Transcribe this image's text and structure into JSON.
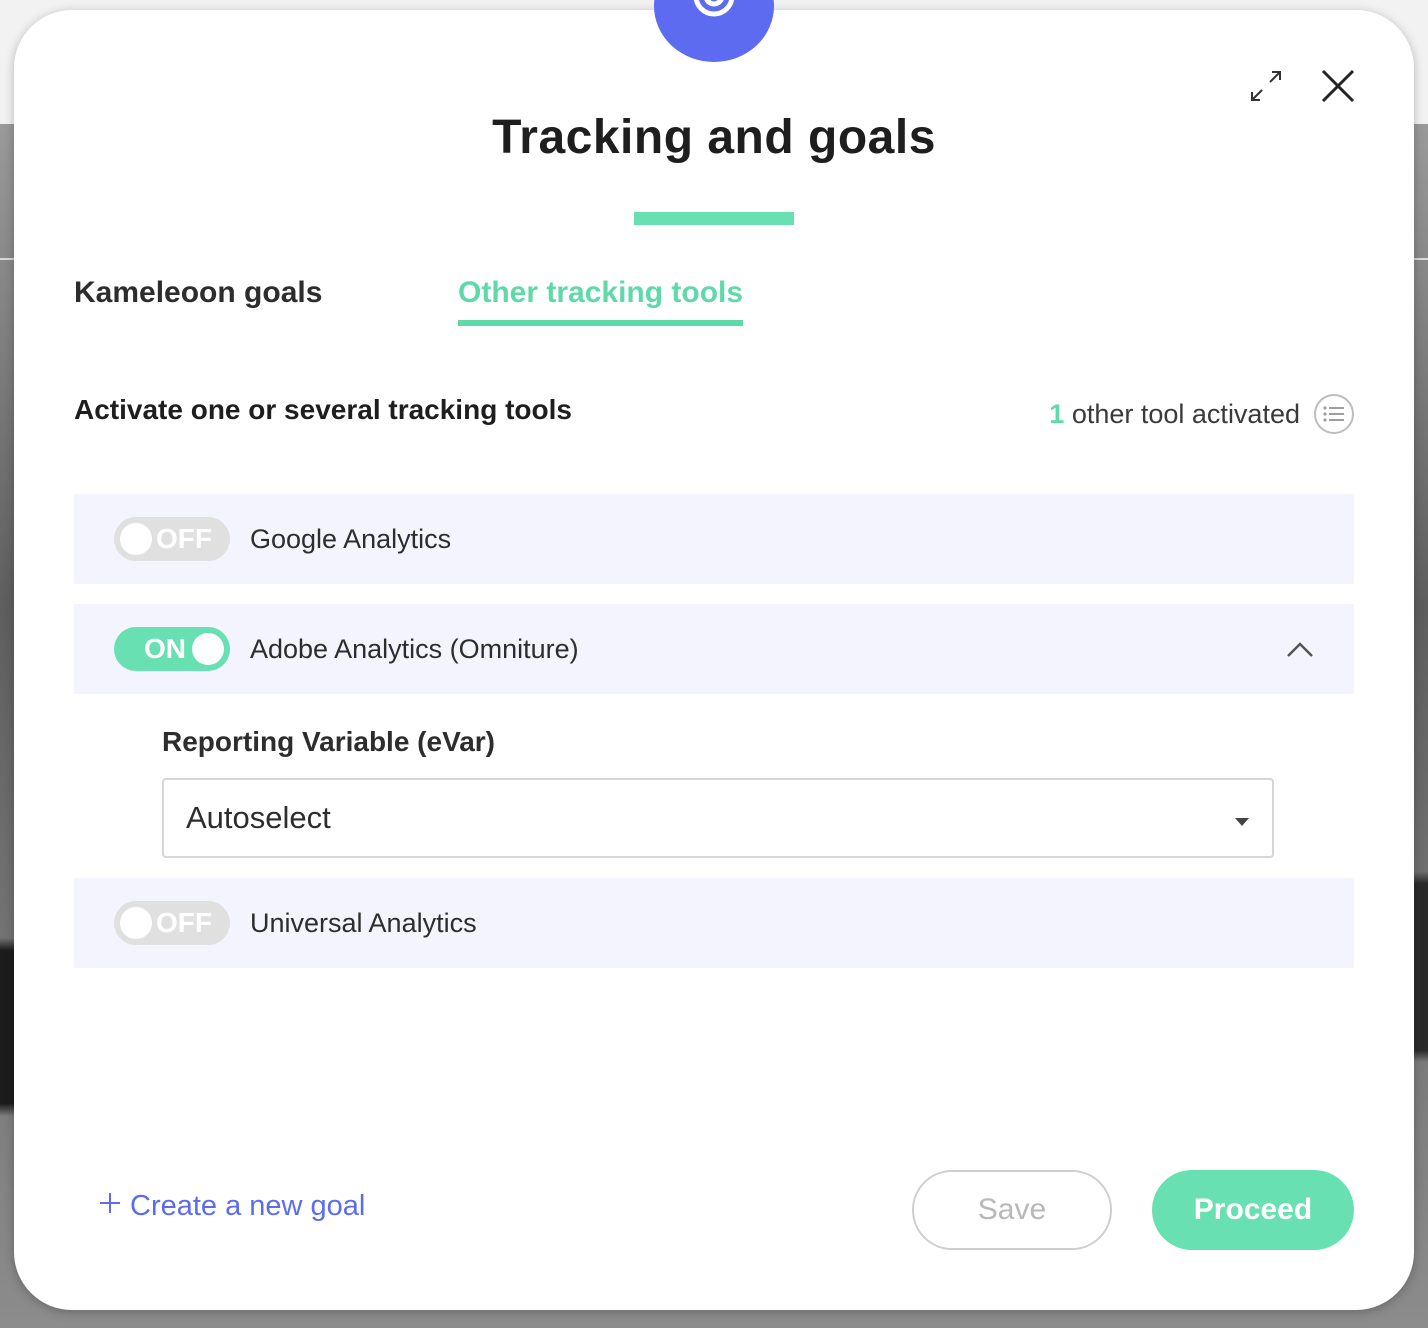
{
  "modal": {
    "title": "Tracking and goals",
    "tabs": [
      {
        "label": "Kameleoon goals",
        "active": false
      },
      {
        "label": "Other tracking tools",
        "active": true
      }
    ],
    "section_heading": "Activate one or several tracking tools",
    "activated": {
      "count": "1",
      "text": "other tool activated"
    },
    "tools": [
      {
        "name": "Google Analytics",
        "state": "OFF"
      },
      {
        "name": "Adobe Analytics (Omniture)",
        "state": "ON",
        "expanded": true
      },
      {
        "name": "Universal Analytics",
        "state": "OFF"
      }
    ],
    "reporting_variable": {
      "label": "Reporting Variable (eVar)",
      "value": "Autoselect"
    },
    "footer": {
      "create_goal": "Create a new goal",
      "save": "Save",
      "proceed": "Proceed"
    }
  },
  "colors": {
    "accent_green": "#69e0b1",
    "brand_blue": "#5c6bef",
    "row_bg": "#f3f4fd"
  },
  "icons": [
    "logo-icon",
    "expand-icon",
    "close-icon",
    "list-icon",
    "chevron-up-icon",
    "caret-down-icon",
    "plus-icon"
  ]
}
